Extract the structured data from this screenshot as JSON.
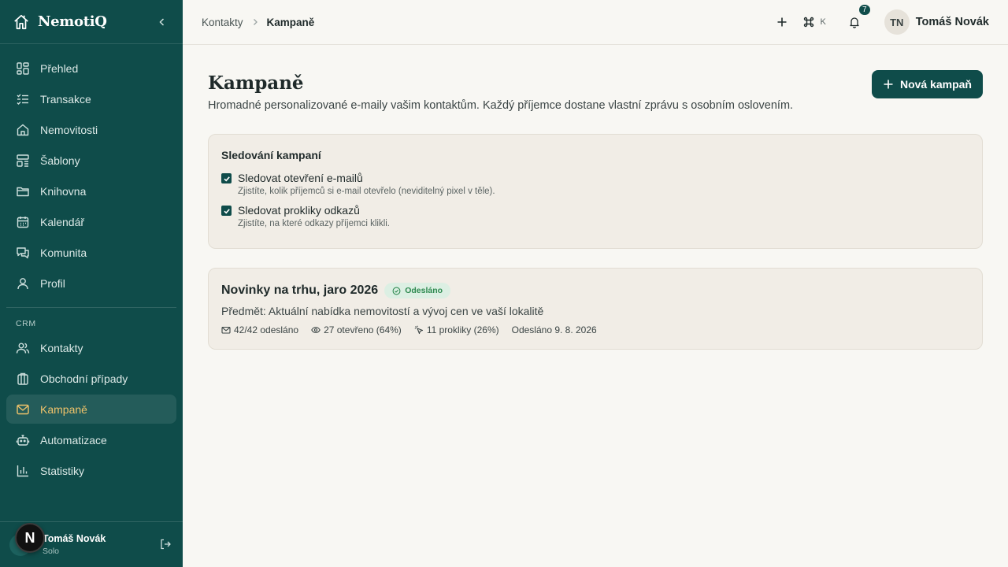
{
  "brand": {
    "name": "NemotiQ"
  },
  "sidebar": {
    "items": [
      {
        "label": "Přehled",
        "icon": "dashboard-icon"
      },
      {
        "label": "Transakce",
        "icon": "list-check-icon"
      },
      {
        "label": "Nemovitosti",
        "icon": "house-icon"
      },
      {
        "label": "Šablony",
        "icon": "template-icon"
      },
      {
        "label": "Knihovna",
        "icon": "folder-icon"
      },
      {
        "label": "Kalendář",
        "icon": "calendar-icon"
      },
      {
        "label": "Komunita",
        "icon": "chat-icon"
      },
      {
        "label": "Profil",
        "icon": "user-icon"
      }
    ],
    "section_label": "CRM",
    "crm_items": [
      {
        "label": "Kontakty",
        "icon": "users-icon"
      },
      {
        "label": "Obchodní případy",
        "icon": "briefcase-icon"
      },
      {
        "label": "Kampaně",
        "icon": "mail-icon",
        "active": true
      },
      {
        "label": "Automatizace",
        "icon": "bot-icon"
      },
      {
        "label": "Statistiky",
        "icon": "bar-chart-icon"
      }
    ],
    "user": {
      "name": "Tomáš Novák",
      "plan": "Solo"
    },
    "fab_letter": "N"
  },
  "topbar": {
    "breadcrumb_parent": "Kontakty",
    "breadcrumb_current": "Kampaně",
    "shortcut_key": "K",
    "notification_count": "7",
    "user_initials": "TN",
    "user_name": "Tomáš Novák"
  },
  "page": {
    "title": "Kampaně",
    "description": "Hromadné personalizované e-maily vašim kontaktům. Každý příjemce dostane vlastní zprávu s osobním oslovením.",
    "new_button": "Nová kampaň"
  },
  "tracking": {
    "title": "Sledování kampaní",
    "options": [
      {
        "label": "Sledovat otevření e-mailů",
        "hint": "Zjistíte, kolik příjemců si e-mail otevřelo (neviditelný pixel v těle).",
        "checked": true
      },
      {
        "label": "Sledovat prokliky odkazů",
        "hint": "Zjistíte, na které odkazy příjemci klikli.",
        "checked": true
      }
    ]
  },
  "campaign": {
    "name": "Novinky na trhu, jaro 2026",
    "status": "Odesláno",
    "subject": "Předmět: Aktuální nabídka nemovitostí a vývoj cen ve vaší lokalitě",
    "sent": "42/42 odesláno",
    "opened": "27 otevřeno (64%)",
    "clicks": "11 prokliky (26%)",
    "sent_date": "Odesláno 9. 8. 2026"
  },
  "colors": {
    "sidebar": "#0f4c4a",
    "accent_active": "#f0c36a",
    "badge_green": "#2e8a50"
  }
}
